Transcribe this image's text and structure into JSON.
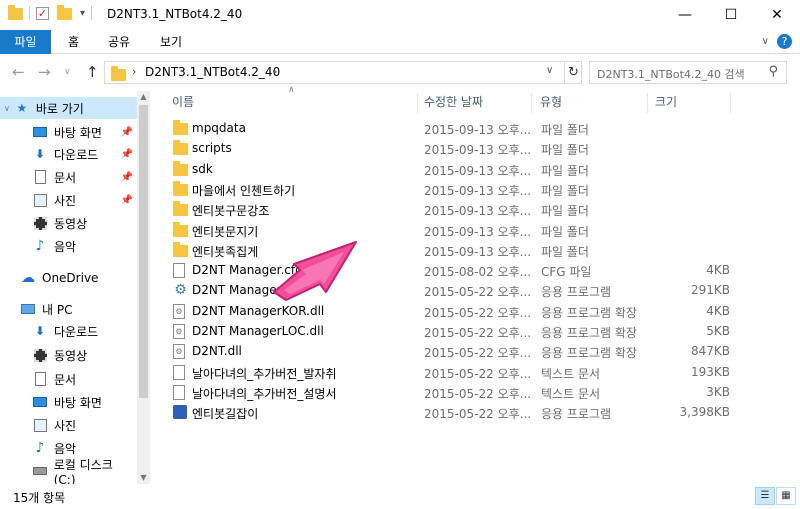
{
  "window": {
    "title": "D2NT3.1_NTBot4.2_40",
    "minimize": "—",
    "maximize": "☐",
    "close": "✕"
  },
  "ribbon": {
    "file_tab": "파일",
    "tabs": [
      "홈",
      "공유",
      "보기"
    ]
  },
  "address": {
    "path": "D2NT3.1_NTBot4.2_40",
    "search_placeholder": "D2NT3.1_NTBot4.2_40 검색"
  },
  "nav": {
    "quick_access": "바로 가기",
    "quick_items": [
      {
        "label": "바탕 화면",
        "icon": "desktop-icon",
        "pinned": true
      },
      {
        "label": "다운로드",
        "icon": "download-icon",
        "pinned": true
      },
      {
        "label": "문서",
        "icon": "document-icon",
        "pinned": true
      },
      {
        "label": "사진",
        "icon": "picture-icon",
        "pinned": true
      },
      {
        "label": "동영상",
        "icon": "video-icon",
        "pinned": false
      },
      {
        "label": "음악",
        "icon": "music-icon",
        "pinned": false
      }
    ],
    "onedrive": "OneDrive",
    "this_pc": "내 PC",
    "pc_items": [
      {
        "label": "다운로드",
        "icon": "download-icon"
      },
      {
        "label": "동영상",
        "icon": "video-icon"
      },
      {
        "label": "문서",
        "icon": "document-icon"
      },
      {
        "label": "바탕 화면",
        "icon": "desktop-icon"
      },
      {
        "label": "사진",
        "icon": "picture-icon"
      },
      {
        "label": "음악",
        "icon": "music-icon"
      },
      {
        "label": "로컬 디스크 (C:)",
        "icon": "drive-icon"
      }
    ]
  },
  "columns": {
    "name": "이름",
    "date": "수정한 날짜",
    "type": "유형",
    "size": "크기"
  },
  "files": [
    {
      "name": "mpqdata",
      "date": "2015-09-13 오후...",
      "type": "파일 폴더",
      "size": "",
      "icon": "folder"
    },
    {
      "name": "scripts",
      "date": "2015-09-13 오후...",
      "type": "파일 폴더",
      "size": "",
      "icon": "folder"
    },
    {
      "name": "sdk",
      "date": "2015-09-13 오후...",
      "type": "파일 폴더",
      "size": "",
      "icon": "folder"
    },
    {
      "name": "마을에서 인첸트하기",
      "date": "2015-09-13 오후...",
      "type": "파일 폴더",
      "size": "",
      "icon": "folder"
    },
    {
      "name": "엔티봇구문강조",
      "date": "2015-09-13 오후...",
      "type": "파일 폴더",
      "size": "",
      "icon": "folder"
    },
    {
      "name": "엔티봇문지기",
      "date": "2015-09-13 오후...",
      "type": "파일 폴더",
      "size": "",
      "icon": "folder"
    },
    {
      "name": "엔티봇족집게",
      "date": "2015-09-13 오후...",
      "type": "파일 폴더",
      "size": "",
      "icon": "folder"
    },
    {
      "name": "D2NT Manager.cfg",
      "date": "2015-08-02 오후...",
      "type": "CFG 파일",
      "size": "4KB",
      "icon": "file"
    },
    {
      "name": "D2NT Manager",
      "date": "2015-05-22 오후...",
      "type": "응용 프로그램",
      "size": "291KB",
      "icon": "gear"
    },
    {
      "name": "D2NT ManagerKOR.dll",
      "date": "2015-05-22 오후...",
      "type": "응용 프로그램 확장",
      "size": "4KB",
      "icon": "dll"
    },
    {
      "name": "D2NT ManagerLOC.dll",
      "date": "2015-05-22 오후...",
      "type": "응용 프로그램 확장",
      "size": "5KB",
      "icon": "dll"
    },
    {
      "name": "D2NT.dll",
      "date": "2015-05-22 오후...",
      "type": "응용 프로그램 확장",
      "size": "847KB",
      "icon": "dll"
    },
    {
      "name": "날아다녀의_추가버전_발자취",
      "date": "2015-05-22 오후...",
      "type": "텍스트 문서",
      "size": "193KB",
      "icon": "file"
    },
    {
      "name": "날아다녀의_추가버전_설명서",
      "date": "2015-05-22 오후...",
      "type": "텍스트 문서",
      "size": "3KB",
      "icon": "file"
    },
    {
      "name": "엔티봇길잡이",
      "date": "2015-05-22 오후...",
      "type": "응용 프로그램",
      "size": "3,398KB",
      "icon": "exe"
    }
  ],
  "status": {
    "item_count": "15개 항목"
  },
  "colors": {
    "accent": "#1979ca",
    "selected": "#cce8ff",
    "annotation_arrow": "#f0509a"
  }
}
